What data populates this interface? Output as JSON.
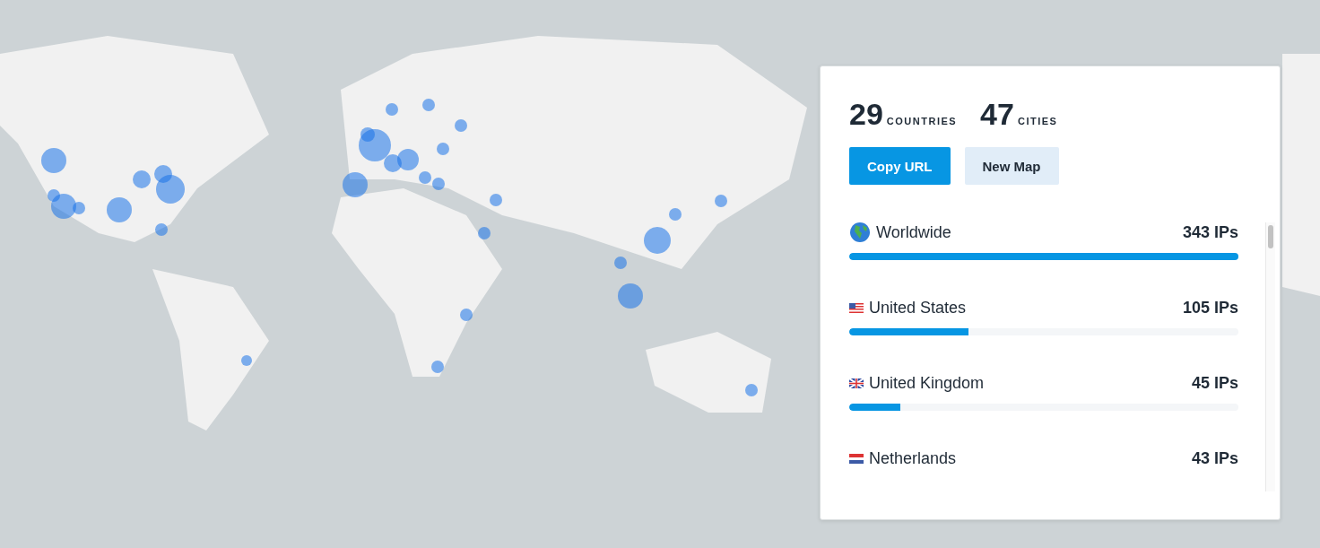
{
  "stats": [
    {
      "value": "29",
      "label": "COUNTRIES"
    },
    {
      "value": "47",
      "label": "CITIES"
    }
  ],
  "buttons": [
    {
      "label": "Copy URL",
      "kind": "primary"
    },
    {
      "label": "New Map",
      "kind": "secondary"
    }
  ],
  "locations": [
    {
      "name": "Worldwide",
      "count": "343 IPs",
      "kind": "globe",
      "level": 1
    },
    {
      "name": "United States",
      "count": "105 IPs",
      "kind": "us",
      "level": 0.306
    },
    {
      "name": "United Kingdom",
      "count": "45 IPs",
      "kind": "uk",
      "level": 0.131
    },
    {
      "name": "Netherlands",
      "count": "43 IPs",
      "kind": "nl"
    }
  ]
}
